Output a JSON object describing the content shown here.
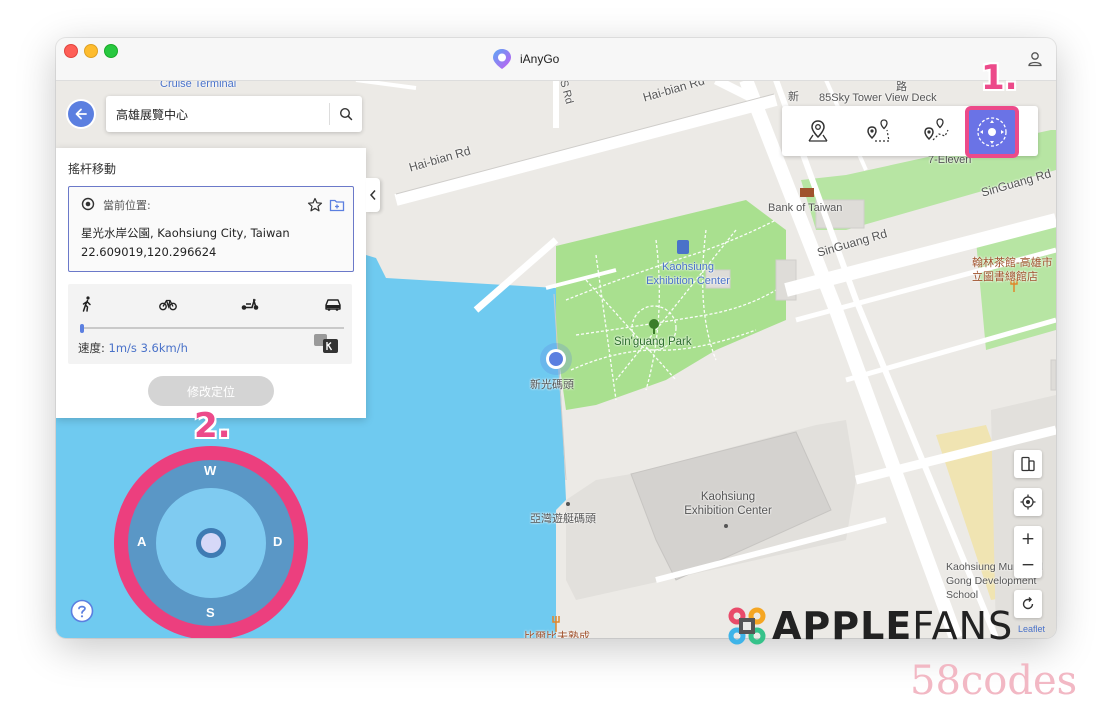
{
  "window": {
    "title": "iAnyGo"
  },
  "search": {
    "value": "高雄展覽中心"
  },
  "panel": {
    "title": "搖杆移動",
    "current_label": "當前位置:",
    "address": "星光水岸公園, Kaohsiung City, Taiwan",
    "coords": "22.609019,120.296624",
    "speed_label": "速度:",
    "speed_value": "1m/s 3.6km/h",
    "speed_level": 0.0,
    "modify_button": "修改定位",
    "transport_modes": [
      "walk-icon",
      "bike-icon",
      "scooter-icon",
      "car-icon"
    ]
  },
  "map_labels": {
    "cruise_terminal": "Cruise Terminal",
    "hai_bian_rd_1": "Hai-bian Rd",
    "hai_bian_rd_2": "Hai-bian Rd",
    "s_rd": "S Rd",
    "sky_tower": "85Sky Tower View Deck",
    "seven_eleven": "7-Eleven",
    "bank_of_taiwan": "Bank of Taiwan",
    "singuang_rd_1": "SinGuang Rd",
    "singuang_rd_2": "SinGuang Rd",
    "exhibition_station": "Kaohsiung Exhibition Center",
    "singuang_park": "Sin'guang Park",
    "pier": "新光碼頭",
    "yacht_pier": "亞灣遊艇碼頭",
    "exhibition_center": "Kaohsiung Exhibition Center",
    "library_cafe": "翰林茶館-高雄市立圖書總館店",
    "gong_dev": "Kaohsiung Municipal Gong Development School",
    "bottom_poi": "比爾比夫熟成",
    "road_char": "路",
    "road_char2": "新"
  },
  "mode_buttons": [
    "teleport-pin-icon",
    "two-spot-route-icon",
    "multi-spot-route-icon",
    "joystick-icon"
  ],
  "steps": {
    "one": "1.",
    "two": "2."
  },
  "joystick": {
    "up": "W",
    "left": "A",
    "right": "D",
    "down": "S"
  },
  "controls": {
    "zoom_in": "+",
    "zoom_out": "−",
    "attribution": "Leaflet"
  },
  "watermark": {
    "brand_bold": "APPLE",
    "brand_light": "FANS",
    "code": "58codes"
  },
  "colors": {
    "accent": "#5b7fe0",
    "highlight": "#ec4a8a",
    "water": "#6fcaf0",
    "park": "#a9e08f"
  }
}
